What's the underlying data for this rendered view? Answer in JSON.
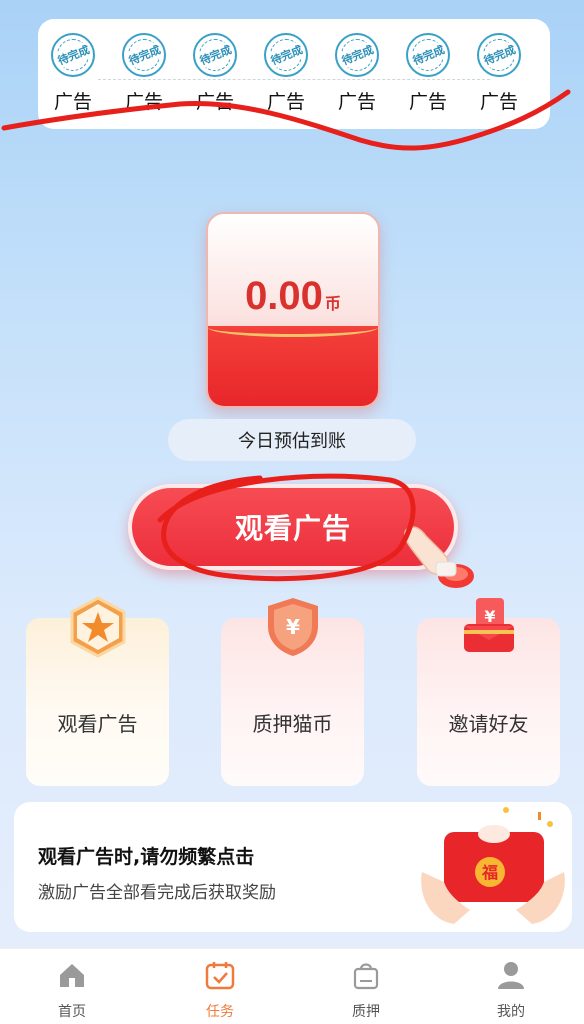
{
  "ad_progress": {
    "slots": [
      {
        "stamp": "待完成",
        "label": "广告"
      },
      {
        "stamp": "待完成",
        "label": "广告"
      },
      {
        "stamp": "待完成",
        "label": "广告"
      },
      {
        "stamp": "待完成",
        "label": "广告"
      },
      {
        "stamp": "待完成",
        "label": "广告"
      },
      {
        "stamp": "待完成",
        "label": "广告"
      },
      {
        "stamp": "待完成",
        "label": "广告"
      }
    ]
  },
  "balance": {
    "value": "0.00",
    "unit": "币",
    "caption": "今日预估到账"
  },
  "watch_button": {
    "label": "观看广告"
  },
  "features": [
    {
      "label": "观看广告",
      "icon": "star-badge-icon"
    },
    {
      "label": "质押猫币",
      "icon": "yuan-shield-icon"
    },
    {
      "label": "邀请好友",
      "icon": "red-envelope-icon"
    }
  ],
  "notice": {
    "title": "观看广告时,请勿频繁点击",
    "subtitle": "激励广告全部看完成后获取奖励"
  },
  "tabbar": {
    "items": [
      {
        "label": "首页",
        "icon": "home-icon",
        "active": false
      },
      {
        "label": "任务",
        "icon": "calendar-check-icon",
        "active": true
      },
      {
        "label": "质押",
        "icon": "bag-icon",
        "active": false
      },
      {
        "label": "我的",
        "icon": "user-icon",
        "active": false
      }
    ]
  },
  "colors": {
    "accent_red": "#ec2f3c",
    "active_tab": "#f07a3a",
    "stamp_blue": "#39a0c7"
  }
}
